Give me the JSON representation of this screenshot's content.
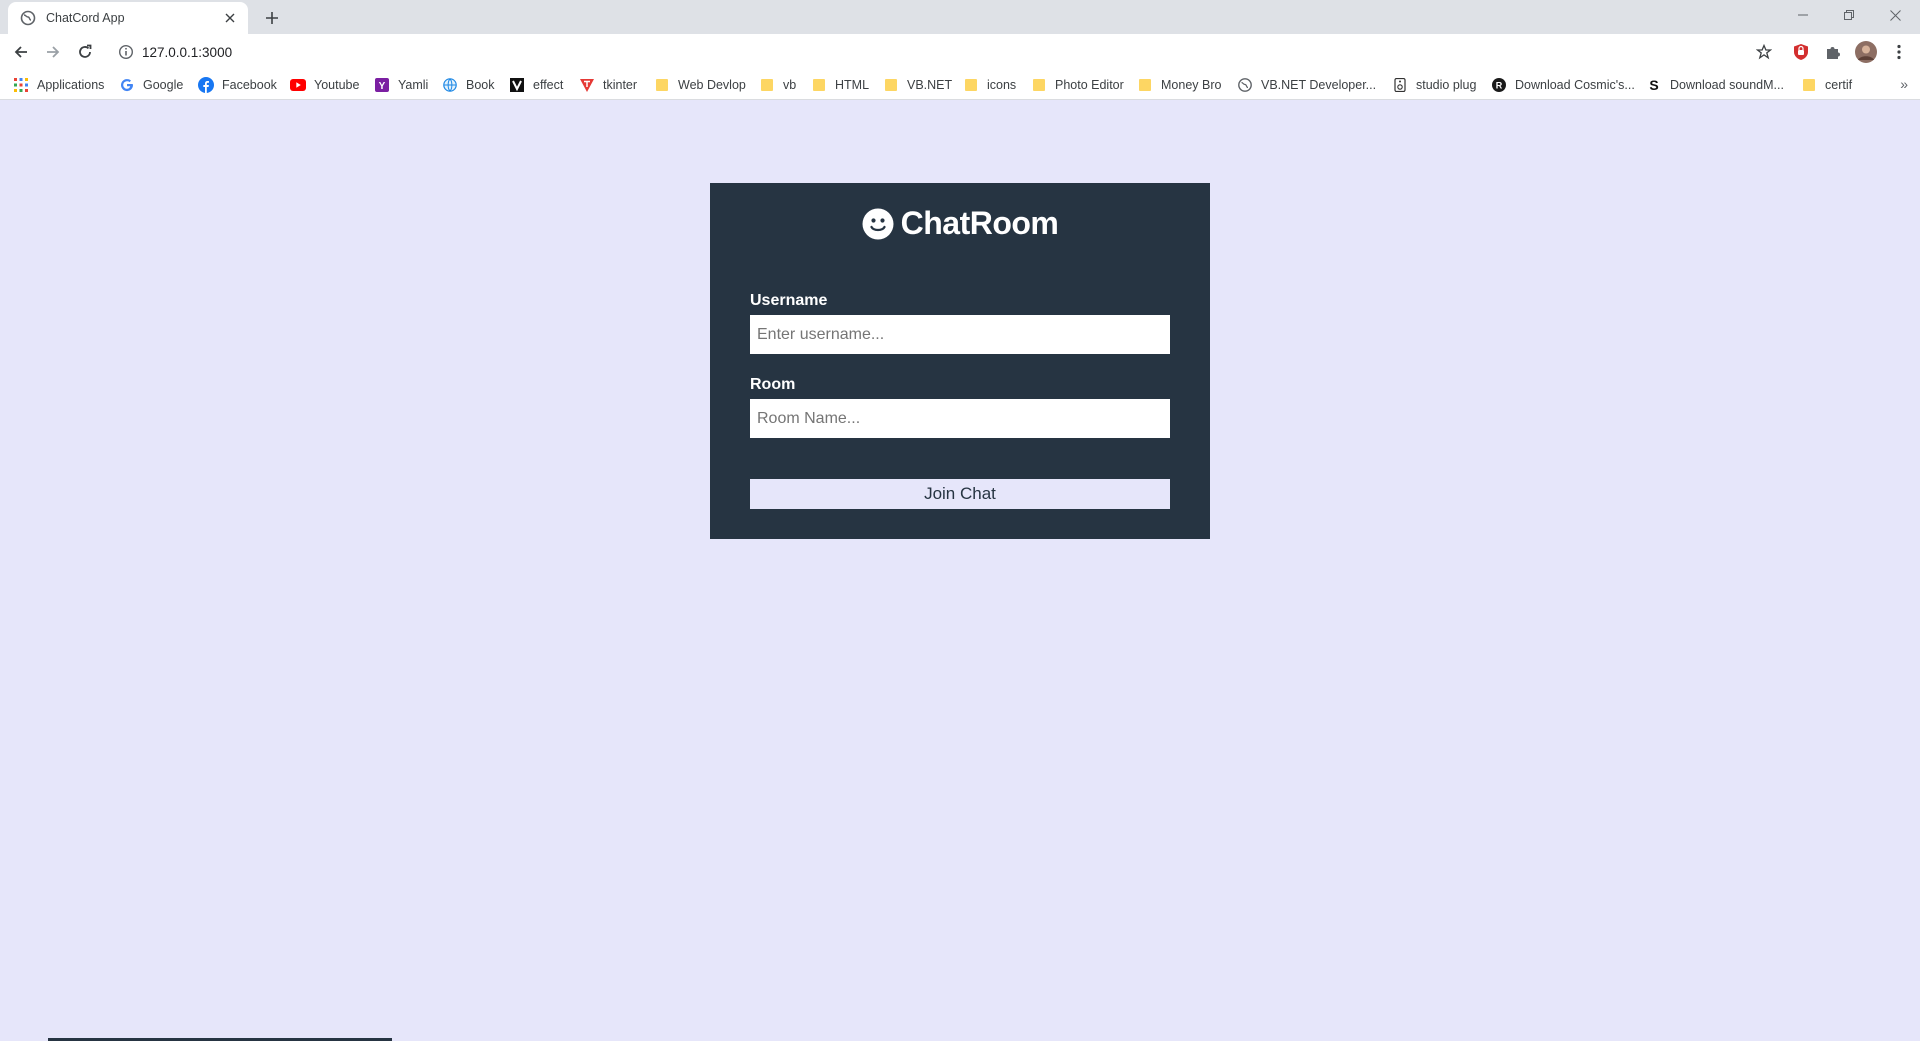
{
  "browser": {
    "tab_title": "ChatCord App",
    "url": "127.0.0.1:3000",
    "bookmarks": [
      {
        "label": "Applications",
        "icon": "apps-grid-icon"
      },
      {
        "label": "Google",
        "icon": "google-icon"
      },
      {
        "label": "Facebook",
        "icon": "facebook-icon"
      },
      {
        "label": "Youtube",
        "icon": "youtube-icon"
      },
      {
        "label": "Yamli",
        "icon": "yamli-icon"
      },
      {
        "label": "Book",
        "icon": "globe-icon"
      },
      {
        "label": "effect",
        "icon": "v-logo-icon"
      },
      {
        "label": "tkinter",
        "icon": "t-logo-icon"
      },
      {
        "label": "Web Devlop",
        "icon": "folder-icon"
      },
      {
        "label": "vb",
        "icon": "folder-icon"
      },
      {
        "label": "HTML",
        "icon": "folder-icon"
      },
      {
        "label": "VB.NET",
        "icon": "folder-icon"
      },
      {
        "label": "icons",
        "icon": "folder-icon"
      },
      {
        "label": "Photo Editor",
        "icon": "folder-icon"
      },
      {
        "label": "Money Bro",
        "icon": "folder-icon"
      },
      {
        "label": "VB.NET Developer...",
        "icon": "globe-dark-icon"
      },
      {
        "label": "studio plug",
        "icon": "speaker-icon"
      },
      {
        "label": "Download Cosmic's...",
        "icon": "r-circle-icon"
      },
      {
        "label": "Download soundM...",
        "icon": "s-logo-icon"
      },
      {
        "label": "certif",
        "icon": "folder-icon"
      }
    ],
    "more_bookmarks": "»"
  },
  "login": {
    "title": "ChatRoom",
    "username_label": "Username",
    "username_placeholder": "Enter username...",
    "room_label": "Room",
    "room_placeholder": "Room Name...",
    "join_label": "Join Chat"
  },
  "colors": {
    "page_bg": "#e6e6fa",
    "card_bg": "#263442"
  }
}
